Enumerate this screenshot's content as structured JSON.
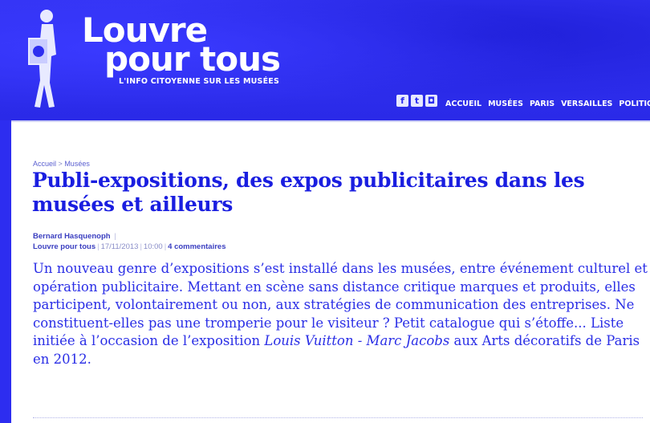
{
  "site": {
    "logo_line1": "Louvre",
    "logo_line2": "pour tous",
    "tagline": "L'INFO CITOYENNE SUR LES MUSÉES"
  },
  "social_icons": [
    "facebook-icon",
    "twitter-icon",
    "instagram-icon"
  ],
  "nav": [
    "ACCUEIL",
    "MUSÉES",
    "PARIS",
    "VERSAILLES",
    "POLITIQUE"
  ],
  "breadcrumb": {
    "home": "Accueil",
    "separator": ">",
    "section": "Musées"
  },
  "article": {
    "title": "Publi-expositions, des expos publicitaires dans les musées et ailleurs",
    "author": "Bernard Hasquenoph",
    "blog": "Louvre pour tous",
    "date": "17/11/2013",
    "time": "10:00",
    "comments": "4 commentaires",
    "lead_part1": "Un nouveau genre d’expositions s’est installé dans les musées, entre événement culturel et opération publicitaire. Mettant en scène sans distance critique marques et produits, elles participent, volontairement ou non, aux stratégies de communication des entreprises. Ne constituent-elles pas une tromperie pour le visiteur ? Petit catalogue qui s’étoffe... Liste initiée à l’occasion de l’exposition ",
    "lead_italic": "Louis Vuitton - Marc Jacobs",
    "lead_part2": " aux Arts décoratifs de Paris en 2012."
  },
  "colors": {
    "brand_blue": "#2d2df0",
    "title_blue": "#1a1ee0",
    "text_blue": "#2a2ee6"
  }
}
